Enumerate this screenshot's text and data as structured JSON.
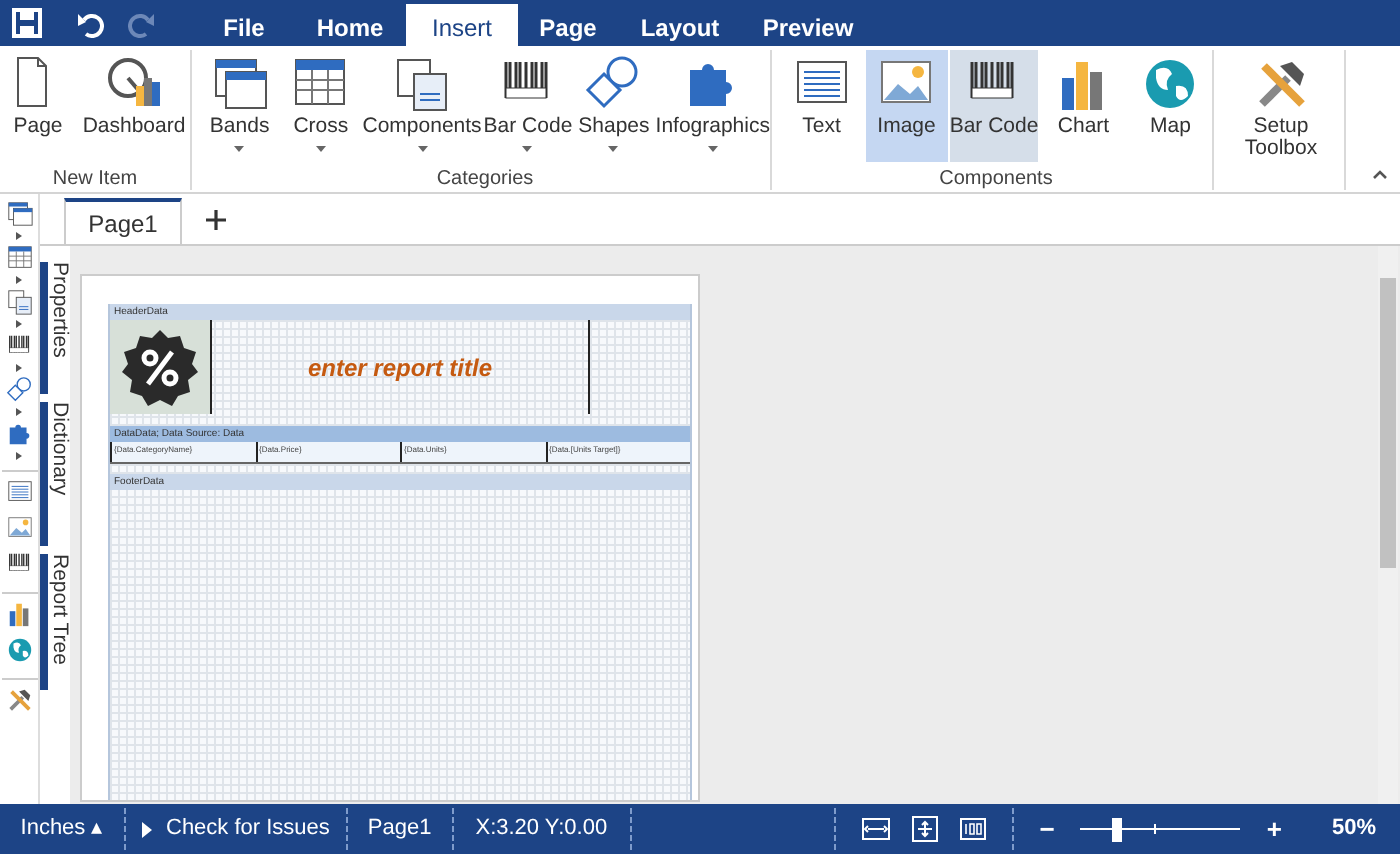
{
  "menu_tabs": [
    {
      "label": "File",
      "selected": false
    },
    {
      "label": "Home",
      "selected": false
    },
    {
      "label": "Insert",
      "selected": true
    },
    {
      "label": "Page",
      "selected": false
    },
    {
      "label": "Layout",
      "selected": false
    },
    {
      "label": "Preview",
      "selected": false
    }
  ],
  "ribbon_groups": [
    {
      "label": "New Item",
      "items": [
        {
          "label": "Page"
        },
        {
          "label": "Dashboard"
        }
      ]
    },
    {
      "label": "Categories",
      "items": [
        {
          "label": "Bands",
          "dropdown": true
        },
        {
          "label": "Cross",
          "dropdown": true
        },
        {
          "label": "Components",
          "dropdown": true
        },
        {
          "label": "Bar Code",
          "dropdown": true
        },
        {
          "label": "Shapes",
          "dropdown": true
        },
        {
          "label": "Infographics",
          "dropdown": true
        }
      ]
    },
    {
      "label": "Components",
      "items": [
        {
          "label": "Text",
          "selected": false,
          "hovered": false
        },
        {
          "label": "Image",
          "selected": true,
          "hovered": false
        },
        {
          "label": "Bar Code",
          "selected": false,
          "hovered": true
        },
        {
          "label": "Chart",
          "selected": false,
          "hovered": false
        },
        {
          "label": "Map",
          "selected": false,
          "hovered": false
        }
      ]
    },
    {
      "items": [
        {
          "label": "Setup Toolbox"
        }
      ]
    }
  ],
  "page_tabs": [
    {
      "label": "Page1",
      "selected": true
    }
  ],
  "side_tabs": [
    "Properties",
    "Dictionary",
    "Report Tree"
  ],
  "report": {
    "header_band": "HeaderData",
    "title": "enter report title",
    "data_band": "DataData; Data Source: Data",
    "data_fields": [
      "{Data.CategoryName}",
      "{Data.Price}",
      "{Data.Units}",
      "{Data.[Units Target]}"
    ],
    "footer_band": "FooterData"
  },
  "status_bar": {
    "units": "Inches ▴",
    "check": "Check for Issues",
    "page": "Page1",
    "position": "X:3.20 Y:0.00",
    "level": 0.22,
    "zoom": "50%",
    "minus": "−",
    "plus": "+"
  }
}
